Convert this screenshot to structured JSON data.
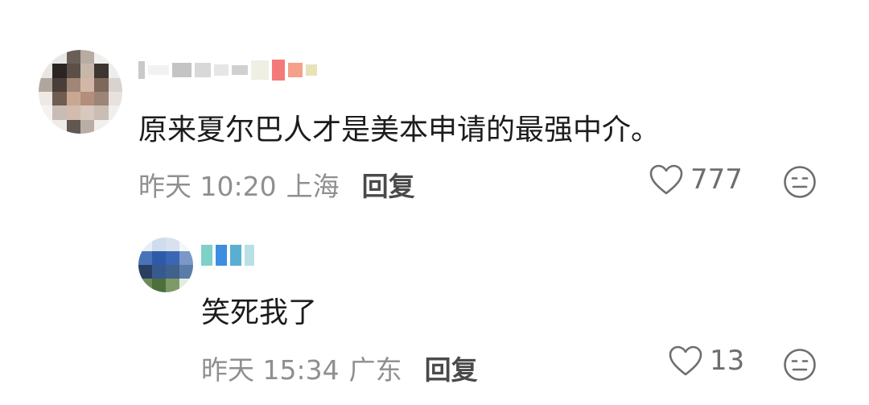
{
  "comments": [
    {
      "text": "原来夏尔巴人才是美本申请的最强中介。",
      "time": "昨天 10:20",
      "location": "上海",
      "reply_label": "回复",
      "likes": "777",
      "avatar_icon": "pixelated-avatar",
      "username_blurred": true
    },
    {
      "text": "笑死我了",
      "time": "昨天 15:34",
      "location": "广东",
      "reply_label": "回复",
      "likes": "13",
      "avatar_icon": "pixelated-avatar",
      "username_blurred": true
    }
  ],
  "icons": {
    "like": "heart-outline-icon",
    "dislike": "neutral-face-icon"
  },
  "colors": {
    "meta_text": "#8f8f8f",
    "body_text": "#1c1c1c",
    "reply_button": "#4a4a4a"
  }
}
